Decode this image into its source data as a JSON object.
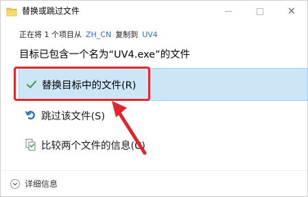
{
  "window": {
    "title": "替换或跳过文件",
    "controls": {
      "minimize": "minimize",
      "maximize": "maximize",
      "close": "✕"
    }
  },
  "info": {
    "prefix": "正在将 1 个项目从",
    "source": "ZH_CN",
    "middle": "复制到",
    "destination": "UV4"
  },
  "headline": "目标已包含一个名为“UV4.exe”的文件",
  "options": {
    "replace": {
      "label": "替换目标中的文件(R)",
      "icon": "checkmark-icon"
    },
    "skip": {
      "label": "跳过该文件(S)",
      "icon": "skip-arrow-icon"
    },
    "compare": {
      "label": "比较两个文件的信息(C)",
      "icon": "compare-files-icon"
    }
  },
  "footer": {
    "details_label": "详细信息",
    "icon": "chevron-down-icon"
  },
  "colors": {
    "accent_link": "#2a6ebf",
    "selected_bg": "#cde6f7",
    "selected_border": "#9ecdf0",
    "check_green": "#3fa34d",
    "annotation_red": "#e0262c"
  }
}
